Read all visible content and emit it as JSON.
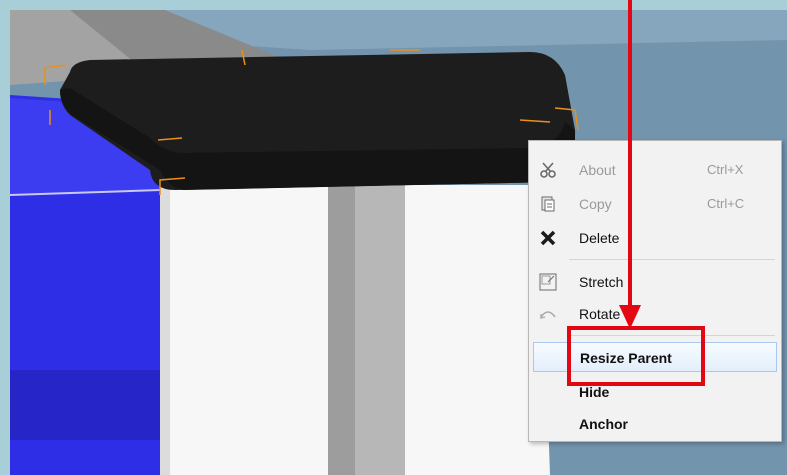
{
  "menu": {
    "items": [
      {
        "label": "About",
        "shortcut": "Ctrl+X",
        "icon": "scissors-icon",
        "disabled": true
      },
      {
        "label": "Copy",
        "shortcut": "Ctrl+C",
        "icon": "copy-icon",
        "disabled": true
      },
      {
        "label": "Delete",
        "shortcut": "",
        "icon": "delete-x-icon",
        "disabled": false
      },
      {
        "label": "Stretch",
        "shortcut": "",
        "icon": "stretch-icon",
        "disabled": false
      },
      {
        "label": "Rotate",
        "shortcut": "",
        "icon": "rotate-icon",
        "disabled": false
      },
      {
        "label": "Resize Parent",
        "shortcut": "",
        "icon": "",
        "disabled": false,
        "highlighted": true
      },
      {
        "label": "Hide",
        "shortcut": "",
        "icon": "",
        "disabled": false
      },
      {
        "label": "Anchor",
        "shortcut": "",
        "icon": "",
        "disabled": false
      }
    ]
  },
  "colors": {
    "sky": "#6f8fa7",
    "blue_block": "#3333dd",
    "black_block": "#1c1c1c",
    "selection": "#e8901a",
    "callout": "#e30613"
  }
}
